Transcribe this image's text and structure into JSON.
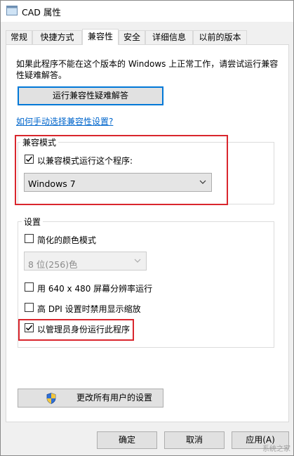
{
  "window": {
    "title": "CAD 属性"
  },
  "tabs": [
    {
      "label": "常规"
    },
    {
      "label": "快捷方式"
    },
    {
      "label": "兼容性"
    },
    {
      "label": "安全"
    },
    {
      "label": "详细信息"
    },
    {
      "label": "以前的版本"
    }
  ],
  "compat": {
    "description": "如果此程序不能在这个版本的 Windows 上正常工作，请尝试运行兼容性疑难解答。",
    "troubleshoot_button": "运行兼容性疑难解答",
    "manual_link": "如何手动选择兼容性设置?",
    "mode_group_title": "兼容模式",
    "mode_checkbox_label": "以兼容模式运行这个程序:",
    "mode_checked": true,
    "mode_select_value": "Windows 7"
  },
  "settings": {
    "group_title": "设置",
    "reduced_color_label": "简化的颜色模式",
    "reduced_color_checked": false,
    "color_select_value": "8 位(256)色",
    "res640_label": "用 640 x 480 屏幕分辨率运行",
    "res640_checked": false,
    "hidpi_label": "高 DPI 设置时禁用显示缩放",
    "hidpi_checked": false,
    "admin_label": "以管理员身份运行此程序",
    "admin_checked": true
  },
  "change_all_button": "更改所有用户的设置",
  "footer": {
    "ok": "确定",
    "cancel": "取消",
    "apply": "应用(A)"
  },
  "watermark": "系统之家",
  "colors": {
    "accent": "#0078d7",
    "highlight_box": "#d9262d",
    "link": "#0066cc"
  }
}
